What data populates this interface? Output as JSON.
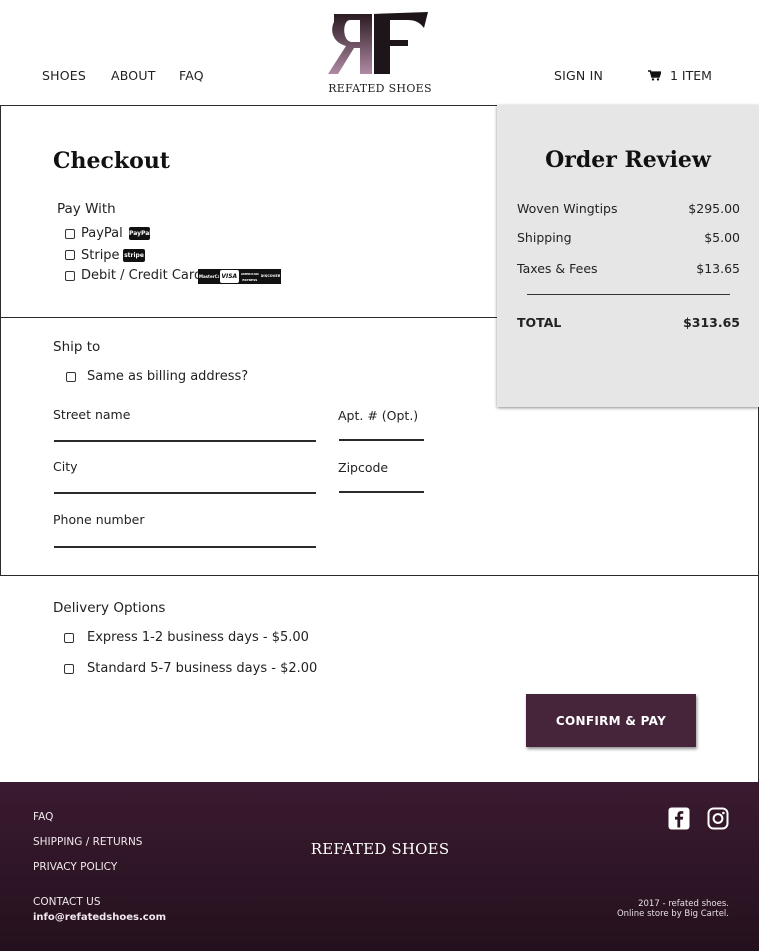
{
  "header": {
    "nav": [
      "SHOES",
      "ABOUT",
      "FAQ"
    ],
    "brand_monogram": "RF",
    "brand_name": "REFATED SHOES",
    "sign_in": "SIGN IN",
    "cart_label": "1 ITEM",
    "cart_icon": "cart-icon"
  },
  "checkout": {
    "title": "Checkout",
    "pay_with_label": "Pay With",
    "payment_options": [
      {
        "label": "PayPal",
        "badge": "PayPal"
      },
      {
        "label": "Stripe",
        "badge": "stripe"
      },
      {
        "label": "Debit / Credit Card",
        "badges": [
          "MasterCard",
          "VISA",
          "AMERICAN EXPRESS",
          "DISCOVER"
        ]
      }
    ]
  },
  "ship_to": {
    "title": "Ship to",
    "same_as_billing": "Same as billing address?",
    "fields": {
      "street": "Street name",
      "apt": "Apt. # (Opt.)",
      "city": "City",
      "zipcode": "Zipcode",
      "phone": "Phone number"
    }
  },
  "delivery": {
    "title": "Delivery Options",
    "options": [
      "Express 1-2 business days - $5.00",
      "Standard 5-7 business days - $2.00"
    ],
    "confirm_label": "CONFIRM & PAY"
  },
  "order_review": {
    "title": "Order Review",
    "items": [
      {
        "name": "Woven Wingtips",
        "price": "$295.00"
      },
      {
        "name": "Shipping",
        "price": "$5.00"
      },
      {
        "name": "Taxes & Fees",
        "price": "$13.65"
      }
    ],
    "total_label": "TOTAL",
    "total_value": "$313.65"
  },
  "footer": {
    "links": [
      "FAQ",
      "SHIPPING / RETURNS",
      "PRIVACY POLICY"
    ],
    "contact_label": "CONTACT US",
    "email": "info@refatedshoes.com",
    "brand": "REFATED SHOES",
    "copyright": "2017 - refated shoes.",
    "store_credit": "Online store by Big Cartel.",
    "social_icons": [
      "facebook-icon",
      "instagram-icon"
    ]
  },
  "colors": {
    "accent": "#46243a",
    "footer_bg": "#2d1525",
    "review_bg": "#e6e6e6"
  }
}
